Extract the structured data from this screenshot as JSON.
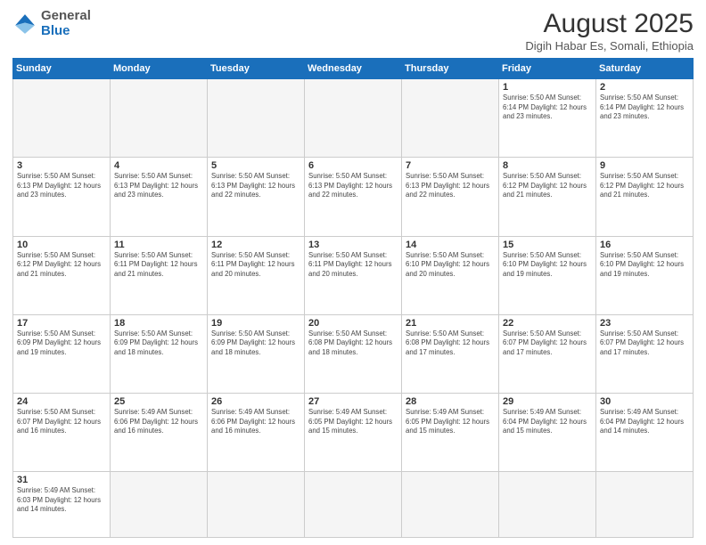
{
  "header": {
    "logo_general": "General",
    "logo_blue": "Blue",
    "title": "August 2025",
    "subtitle": "Digih Habar Es, Somali, Ethiopia"
  },
  "days_of_week": [
    "Sunday",
    "Monday",
    "Tuesday",
    "Wednesday",
    "Thursday",
    "Friday",
    "Saturday"
  ],
  "weeks": [
    [
      {
        "day": "",
        "info": ""
      },
      {
        "day": "",
        "info": ""
      },
      {
        "day": "",
        "info": ""
      },
      {
        "day": "",
        "info": ""
      },
      {
        "day": "",
        "info": ""
      },
      {
        "day": "1",
        "info": "Sunrise: 5:50 AM\nSunset: 6:14 PM\nDaylight: 12 hours\nand 23 minutes."
      },
      {
        "day": "2",
        "info": "Sunrise: 5:50 AM\nSunset: 6:14 PM\nDaylight: 12 hours\nand 23 minutes."
      }
    ],
    [
      {
        "day": "3",
        "info": "Sunrise: 5:50 AM\nSunset: 6:13 PM\nDaylight: 12 hours\nand 23 minutes."
      },
      {
        "day": "4",
        "info": "Sunrise: 5:50 AM\nSunset: 6:13 PM\nDaylight: 12 hours\nand 23 minutes."
      },
      {
        "day": "5",
        "info": "Sunrise: 5:50 AM\nSunset: 6:13 PM\nDaylight: 12 hours\nand 22 minutes."
      },
      {
        "day": "6",
        "info": "Sunrise: 5:50 AM\nSunset: 6:13 PM\nDaylight: 12 hours\nand 22 minutes."
      },
      {
        "day": "7",
        "info": "Sunrise: 5:50 AM\nSunset: 6:13 PM\nDaylight: 12 hours\nand 22 minutes."
      },
      {
        "day": "8",
        "info": "Sunrise: 5:50 AM\nSunset: 6:12 PM\nDaylight: 12 hours\nand 21 minutes."
      },
      {
        "day": "9",
        "info": "Sunrise: 5:50 AM\nSunset: 6:12 PM\nDaylight: 12 hours\nand 21 minutes."
      }
    ],
    [
      {
        "day": "10",
        "info": "Sunrise: 5:50 AM\nSunset: 6:12 PM\nDaylight: 12 hours\nand 21 minutes."
      },
      {
        "day": "11",
        "info": "Sunrise: 5:50 AM\nSunset: 6:11 PM\nDaylight: 12 hours\nand 21 minutes."
      },
      {
        "day": "12",
        "info": "Sunrise: 5:50 AM\nSunset: 6:11 PM\nDaylight: 12 hours\nand 20 minutes."
      },
      {
        "day": "13",
        "info": "Sunrise: 5:50 AM\nSunset: 6:11 PM\nDaylight: 12 hours\nand 20 minutes."
      },
      {
        "day": "14",
        "info": "Sunrise: 5:50 AM\nSunset: 6:10 PM\nDaylight: 12 hours\nand 20 minutes."
      },
      {
        "day": "15",
        "info": "Sunrise: 5:50 AM\nSunset: 6:10 PM\nDaylight: 12 hours\nand 19 minutes."
      },
      {
        "day": "16",
        "info": "Sunrise: 5:50 AM\nSunset: 6:10 PM\nDaylight: 12 hours\nand 19 minutes."
      }
    ],
    [
      {
        "day": "17",
        "info": "Sunrise: 5:50 AM\nSunset: 6:09 PM\nDaylight: 12 hours\nand 19 minutes."
      },
      {
        "day": "18",
        "info": "Sunrise: 5:50 AM\nSunset: 6:09 PM\nDaylight: 12 hours\nand 18 minutes."
      },
      {
        "day": "19",
        "info": "Sunrise: 5:50 AM\nSunset: 6:09 PM\nDaylight: 12 hours\nand 18 minutes."
      },
      {
        "day": "20",
        "info": "Sunrise: 5:50 AM\nSunset: 6:08 PM\nDaylight: 12 hours\nand 18 minutes."
      },
      {
        "day": "21",
        "info": "Sunrise: 5:50 AM\nSunset: 6:08 PM\nDaylight: 12 hours\nand 17 minutes."
      },
      {
        "day": "22",
        "info": "Sunrise: 5:50 AM\nSunset: 6:07 PM\nDaylight: 12 hours\nand 17 minutes."
      },
      {
        "day": "23",
        "info": "Sunrise: 5:50 AM\nSunset: 6:07 PM\nDaylight: 12 hours\nand 17 minutes."
      }
    ],
    [
      {
        "day": "24",
        "info": "Sunrise: 5:50 AM\nSunset: 6:07 PM\nDaylight: 12 hours\nand 16 minutes."
      },
      {
        "day": "25",
        "info": "Sunrise: 5:49 AM\nSunset: 6:06 PM\nDaylight: 12 hours\nand 16 minutes."
      },
      {
        "day": "26",
        "info": "Sunrise: 5:49 AM\nSunset: 6:06 PM\nDaylight: 12 hours\nand 16 minutes."
      },
      {
        "day": "27",
        "info": "Sunrise: 5:49 AM\nSunset: 6:05 PM\nDaylight: 12 hours\nand 15 minutes."
      },
      {
        "day": "28",
        "info": "Sunrise: 5:49 AM\nSunset: 6:05 PM\nDaylight: 12 hours\nand 15 minutes."
      },
      {
        "day": "29",
        "info": "Sunrise: 5:49 AM\nSunset: 6:04 PM\nDaylight: 12 hours\nand 15 minutes."
      },
      {
        "day": "30",
        "info": "Sunrise: 5:49 AM\nSunset: 6:04 PM\nDaylight: 12 hours\nand 14 minutes."
      }
    ],
    [
      {
        "day": "31",
        "info": "Sunrise: 5:49 AM\nSunset: 6:03 PM\nDaylight: 12 hours\nand 14 minutes."
      },
      {
        "day": "",
        "info": ""
      },
      {
        "day": "",
        "info": ""
      },
      {
        "day": "",
        "info": ""
      },
      {
        "day": "",
        "info": ""
      },
      {
        "day": "",
        "info": ""
      },
      {
        "day": "",
        "info": ""
      }
    ]
  ]
}
